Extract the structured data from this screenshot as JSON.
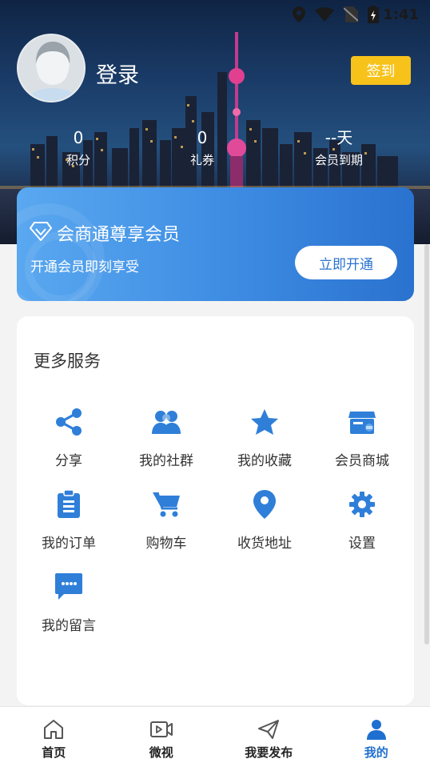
{
  "status": {
    "time": "1:41"
  },
  "header": {
    "login_label": "登录",
    "signin_label": "签到",
    "stats": [
      {
        "value": "0",
        "label": "积分"
      },
      {
        "value": "0",
        "label": "礼券"
      },
      {
        "value": "--天",
        "label": "会员到期"
      }
    ]
  },
  "member": {
    "title": "会商通尊享会员",
    "subtitle": "开通会员即刻享受",
    "button_label": "立即开通"
  },
  "services": {
    "title": "更多服务",
    "items": [
      {
        "label": "分享",
        "icon": "share-icon"
      },
      {
        "label": "我的社群",
        "icon": "group-icon"
      },
      {
        "label": "我的收藏",
        "icon": "star-icon"
      },
      {
        "label": "会员商城",
        "icon": "store-icon"
      },
      {
        "label": "我的订单",
        "icon": "clipboard-icon"
      },
      {
        "label": "购物车",
        "icon": "cart-icon"
      },
      {
        "label": "收货地址",
        "icon": "location-pin-icon"
      },
      {
        "label": "设置",
        "icon": "gear-icon"
      },
      {
        "label": "我的留言",
        "icon": "message-icon"
      }
    ]
  },
  "nav": {
    "items": [
      {
        "label": "首页",
        "icon": "home-icon"
      },
      {
        "label": "微视",
        "icon": "video-icon"
      },
      {
        "label": "我要发布",
        "icon": "send-icon"
      },
      {
        "label": "我的",
        "icon": "person-icon",
        "active": true
      }
    ]
  },
  "colors": {
    "accent": "#1f6fd0",
    "signin": "#f7c21a",
    "icon_blue": "#2f7fd9"
  }
}
